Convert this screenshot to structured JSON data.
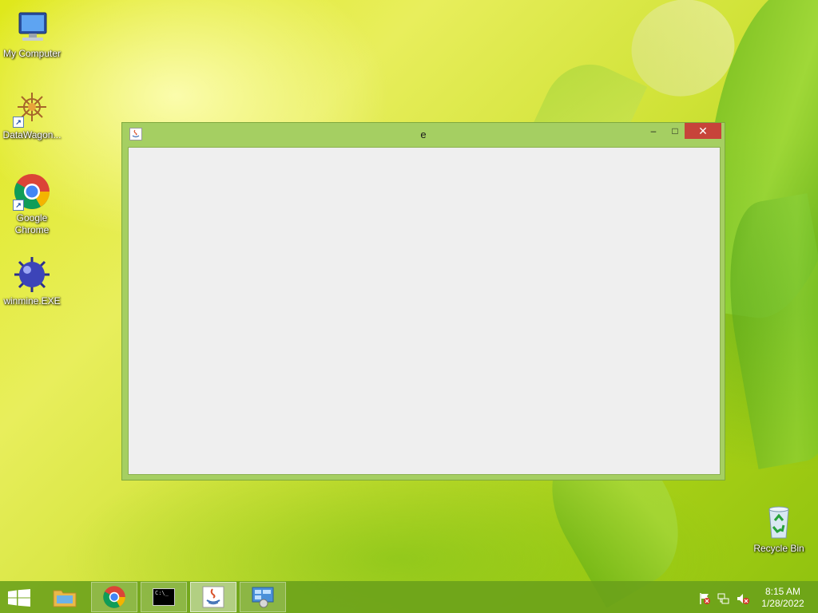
{
  "desktop": {
    "icons": [
      {
        "label": "My Computer",
        "icon": "computer-icon"
      },
      {
        "label": "DataWagon...",
        "icon": "datawagon-icon"
      },
      {
        "label": "Google Chrome",
        "icon": "chrome-icon"
      },
      {
        "label": "winmine.EXE",
        "icon": "mine-icon"
      },
      {
        "label": "Recycle Bin",
        "icon": "recycle-bin-icon"
      }
    ]
  },
  "window": {
    "title": "e",
    "icon": "java-icon",
    "controls": {
      "minimize": "–",
      "maximize": "□",
      "close": "✕"
    }
  },
  "taskbar": {
    "items": [
      {
        "name": "start-button",
        "icon": "windows-logo-icon"
      },
      {
        "name": "file-explorer",
        "icon": "folder-icon"
      },
      {
        "name": "chrome",
        "icon": "chrome-icon"
      },
      {
        "name": "command-prompt",
        "icon": "cmd-icon",
        "glyph": "C:\\_"
      },
      {
        "name": "java-app",
        "icon": "java-icon"
      },
      {
        "name": "control-panel",
        "icon": "control-panel-icon"
      }
    ],
    "tray": {
      "icons": [
        "flag-icon",
        "network-icon",
        "speaker-muted-icon"
      ],
      "time": "8:15 AM",
      "date": "1/28/2022"
    }
  },
  "colors": {
    "close_button": "#c7433a",
    "window_frame": "#a5cf62",
    "taskbar": "#6aa01a"
  }
}
